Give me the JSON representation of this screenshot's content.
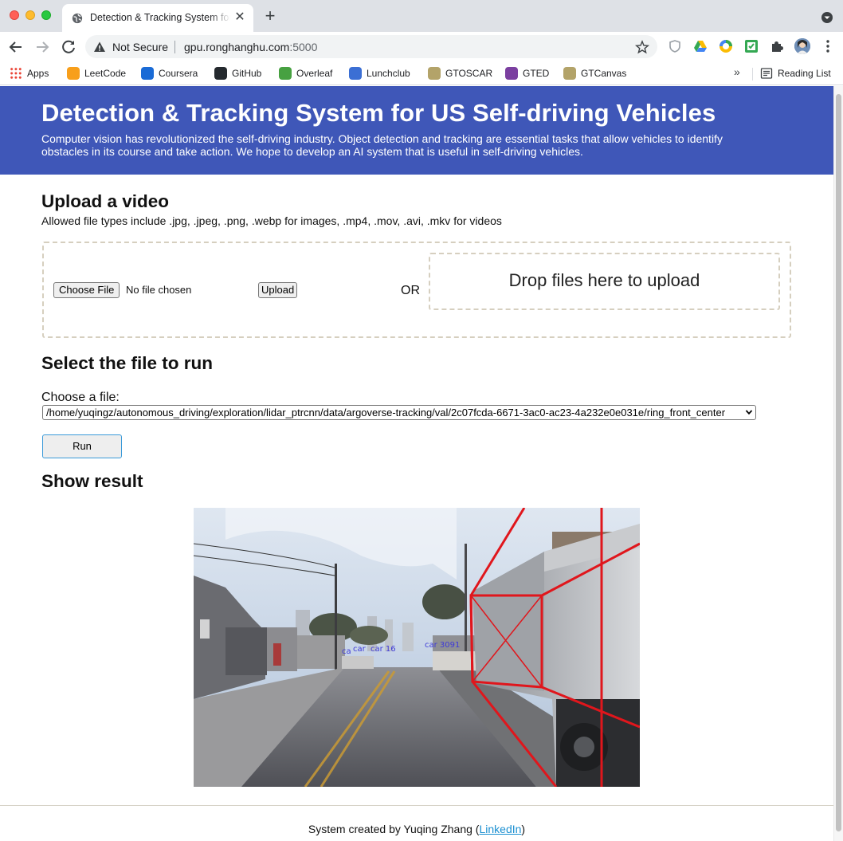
{
  "browser": {
    "tab_title": "Detection & Tracking System for US Self-driving Vehicles",
    "tab_close": "✕",
    "new_tab": "+",
    "security_label": "Not Secure",
    "url_host": "gpu.ronghanghu.com",
    "url_port": ":5000",
    "bookmarks": [
      {
        "label": "Apps",
        "icon": "apps-grid-icon",
        "color": "#ea4335"
      },
      {
        "label": "LeetCode",
        "icon": "leetcode-icon",
        "color": "#f89f1b"
      },
      {
        "label": "Coursera",
        "icon": "coursera-icon",
        "color": "#1a6bd6"
      },
      {
        "label": "GitHub",
        "icon": "github-icon",
        "color": "#24292e"
      },
      {
        "label": "Overleaf",
        "icon": "overleaf-icon",
        "color": "#47a141"
      },
      {
        "label": "Lunchclub",
        "icon": "lunchclub-icon",
        "color": "#3b6fd4"
      },
      {
        "label": "GTOSCAR",
        "icon": "gtoscar-icon",
        "color": "#b3a369"
      },
      {
        "label": "GTED",
        "icon": "gted-icon",
        "color": "#7b3fa0"
      },
      {
        "label": "GTCanvas",
        "icon": "gtcanvas-icon",
        "color": "#b3a369"
      }
    ],
    "bookmarks_more": "»",
    "reading_list": "Reading List"
  },
  "header": {
    "title": "Detection & Tracking System for US Self-driving Vehicles",
    "description": "Computer vision has revolutionized the self-driving industry. Object detection and tracking are essential tasks that allow vehicles to identify obstacles in its course and take action. We hope to develop an AI system that is useful in self-driving vehicles.",
    "background": "#3f57b8"
  },
  "upload": {
    "heading": "Upload a video",
    "allowed_types": "Allowed file types include .jpg, .jpeg, .png, .webp for images, .mp4, .mov, .avi, .mkv for videos",
    "choose_file_label": "Choose File",
    "no_file_text": "No file chosen",
    "upload_button": "Upload",
    "or_text": "OR",
    "dropzone_text": "Drop files here to upload"
  },
  "select": {
    "heading": "Select the file to run",
    "choose_label": "Choose a file:",
    "selected_value": "/home/yuqingz/autonomous_driving/exploration/lidar_ptrcnn/data/argoverse-tracking/val/2c07fcda-6671-3ac0-ac23-4a232e0e031e/ring_front_center",
    "run_button": "Run"
  },
  "result": {
    "heading": "Show result",
    "detection_labels": [
      "ca",
      "car",
      "car 16",
      "car 309",
      "1"
    ]
  },
  "footer": {
    "prefix": "System created by Yuqing Zhang (",
    "link_text": "LinkedIn",
    "suffix": ")"
  }
}
